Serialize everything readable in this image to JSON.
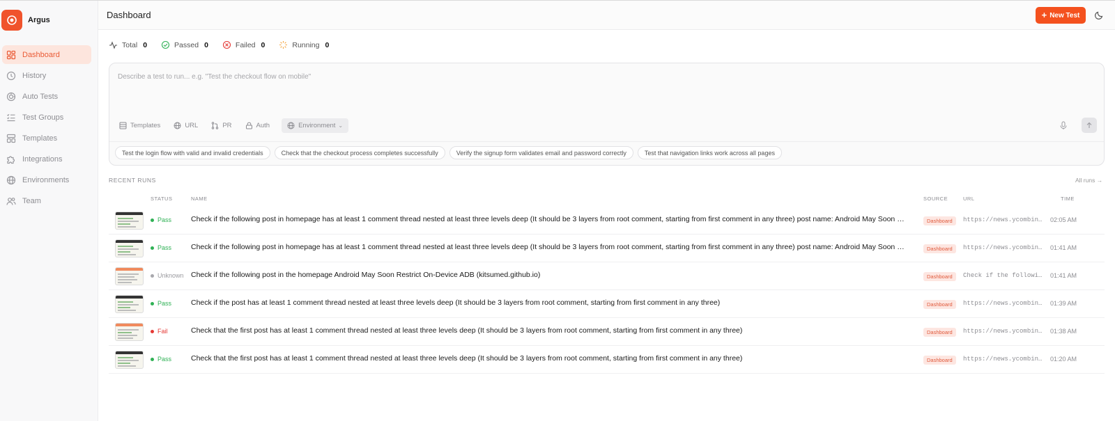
{
  "app": {
    "name": "Argus"
  },
  "sidebar": {
    "items": [
      {
        "label": "Dashboard",
        "icon": "dashboard-icon",
        "active": true
      },
      {
        "label": "History",
        "icon": "clock-icon",
        "active": false
      },
      {
        "label": "Auto Tests",
        "icon": "auto-test-icon",
        "active": false
      },
      {
        "label": "Test Groups",
        "icon": "checklist-icon",
        "active": false
      },
      {
        "label": "Templates",
        "icon": "templates-icon",
        "active": false
      },
      {
        "label": "Integrations",
        "icon": "puzzle-icon",
        "active": false
      },
      {
        "label": "Environments",
        "icon": "globe-icon",
        "active": false
      },
      {
        "label": "Team",
        "icon": "team-icon",
        "active": false
      }
    ]
  },
  "header": {
    "title": "Dashboard",
    "new_test_label": "New Test",
    "accent": "#f4511e"
  },
  "stats": {
    "total_label": "Total",
    "total": "0",
    "passed_label": "Passed",
    "passed": "0",
    "failed_label": "Failed",
    "failed": "0",
    "running_label": "Running",
    "running": "0"
  },
  "composer": {
    "placeholder": "Describe a test to run... e.g. \"Test the checkout flow on mobile\"",
    "tools": {
      "templates": "Templates",
      "url": "URL",
      "pr": "PR",
      "auth": "Auth",
      "environment": "Environment"
    },
    "suggestions": [
      "Test the login flow with valid and invalid credentials",
      "Check that the checkout process completes successfully",
      "Verify the signup form validates email and password correctly",
      "Test that navigation links work across all pages"
    ]
  },
  "recent": {
    "title": "RECENT RUNS",
    "all_runs_label": "All runs →",
    "columns": {
      "status": "STATUS",
      "name": "NAME",
      "source": "SOURCE",
      "url": "URL",
      "time": "TIME"
    },
    "rows": [
      {
        "status": "Pass",
        "name": "Check if the following post in homepage has at least 1 comment thread nested at least three levels deep (It should be 3 layers from root comment, starting from first comment in any three) post name: Android May Soon Restrict On-Device ADB",
        "source": "Dashboard",
        "url": "https://news.ycombinator.com",
        "time": "02:05 AM"
      },
      {
        "status": "Pass",
        "name": "Check if the following post in homepage has at least 1 comment thread nested at least three levels deep (It should be 3 layers from root comment, starting from first comment in any three) post name: Android May Soon Restrict On-Device ADB",
        "source": "Dashboard",
        "url": "https://news.ycombinator.com",
        "time": "01:41 AM"
      },
      {
        "status": "Unknown",
        "name": "Check if the following post in the homepage Android May Soon Restrict On-Device ADB (kitsumed.github.io)",
        "source": "Dashboard",
        "url": "Check if the following post",
        "time": "01:41 AM"
      },
      {
        "status": "Pass",
        "name": "Check if the post has at least 1 comment thread nested at least three levels deep (It should be 3 layers from root comment, starting from first comment in any three)",
        "source": "Dashboard",
        "url": "https://news.ycombinator.com",
        "time": "01:39 AM"
      },
      {
        "status": "Fail",
        "name": "Check that the first post has at least 1 comment thread nested at least three levels deep (It should be 3 layers from root comment, starting from first comment in any three)",
        "source": "Dashboard",
        "url": "https://news.ycombinator.com",
        "time": "01:38 AM"
      },
      {
        "status": "Pass",
        "name": "Check that the first post has at least 1 comment thread nested at least three levels deep (It should be 3 layers from root comment, starting from first comment in any three)",
        "source": "Dashboard",
        "url": "https://news.ycombinator.com",
        "time": "01:20 AM"
      }
    ]
  }
}
